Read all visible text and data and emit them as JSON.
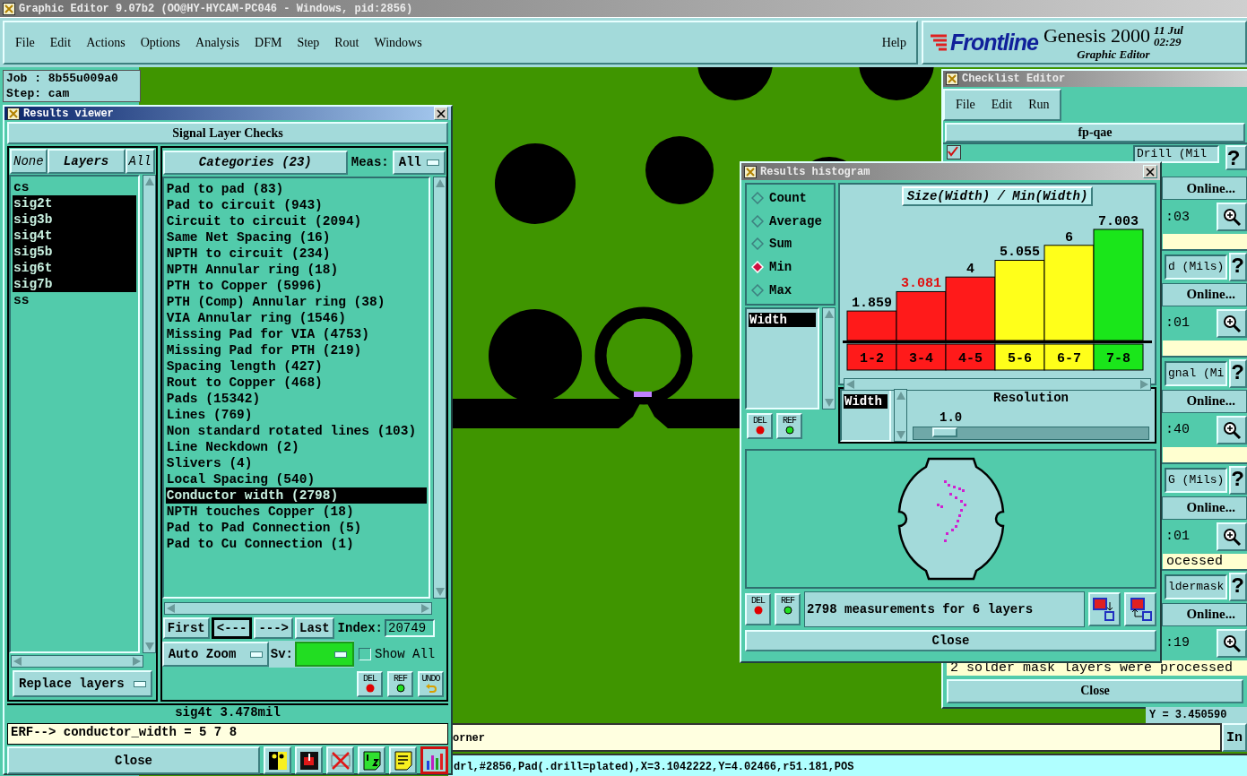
{
  "app": {
    "title": "Graphic Editor 9.07b2 (OO@HY-HYCAM-PC046 - Windows, pid:2856)",
    "active": false
  },
  "menu": [
    "File",
    "Edit",
    "Actions",
    "Options",
    "Analysis",
    "DFM",
    "Step",
    "Rout",
    "Windows"
  ],
  "help": "Help",
  "brand": {
    "logo": "Frontline",
    "product": "Genesis 2000",
    "subtitle": "Graphic Editor",
    "date": "11 Jul",
    "time": "02:29"
  },
  "job_info": [
    "Job : 8b55u009a0",
    "Step: cam"
  ],
  "results_viewer": {
    "title": "Results viewer",
    "active": true,
    "heading": "Signal Layer Checks",
    "layer_buttons": [
      {
        "label": "None",
        "kind": "button"
      },
      {
        "label": "Layers",
        "kind": "label"
      },
      {
        "label": "All",
        "kind": "button"
      }
    ],
    "layers": [
      {
        "label": "cs",
        "selected": false
      },
      {
        "label": "sig2t",
        "selected": true
      },
      {
        "label": "sig3b",
        "selected": true
      },
      {
        "label": "sig4t",
        "selected": true
      },
      {
        "label": "sig5b",
        "selected": true
      },
      {
        "label": "sig6t",
        "selected": true
      },
      {
        "label": "sig7b",
        "selected": true
      },
      {
        "label": "ss",
        "selected": false
      }
    ],
    "replace_mode": "Replace layers",
    "categories_heading": "Categories (23)",
    "meas_label": "Meas:",
    "meas_value": "All",
    "categories": [
      {
        "label": "Pad to pad (83)",
        "selected": false
      },
      {
        "label": "Pad to circuit (943)",
        "selected": false
      },
      {
        "label": "Circuit to circuit (2094)",
        "selected": false
      },
      {
        "label": "Same Net Spacing (16)",
        "selected": false
      },
      {
        "label": "NPTH to circuit (234)",
        "selected": false
      },
      {
        "label": "NPTH Annular ring (18)",
        "selected": false
      },
      {
        "label": "PTH to Copper (5996)",
        "selected": false
      },
      {
        "label": "PTH (Comp) Annular ring (38)",
        "selected": false
      },
      {
        "label": "VIA Annular ring (1546)",
        "selected": false
      },
      {
        "label": "Missing Pad for VIA (4753)",
        "selected": false
      },
      {
        "label": "Missing Pad for PTH (219)",
        "selected": false
      },
      {
        "label": "Spacing length (427)",
        "selected": false
      },
      {
        "label": "Rout to Copper (468)",
        "selected": false
      },
      {
        "label": "Pads (15342)",
        "selected": false
      },
      {
        "label": "Lines (769)",
        "selected": false
      },
      {
        "label": "Non standard rotated lines (103)",
        "selected": false
      },
      {
        "label": "Line Neckdown (2)",
        "selected": false
      },
      {
        "label": "Slivers (4)",
        "selected": false
      },
      {
        "label": "Local Spacing (540)",
        "selected": false
      },
      {
        "label": "Conductor width (2798)",
        "selected": true
      },
      {
        "label": "NPTH touches Copper (18)",
        "selected": false
      },
      {
        "label": "Pad to Pad Connection (5)",
        "selected": false
      },
      {
        "label": "Pad to Cu Connection (1)",
        "selected": false
      }
    ],
    "nav_buttons": [
      {
        "label": "First",
        "pressed": false
      },
      {
        "label": "<---",
        "pressed": true
      },
      {
        "label": "--->",
        "pressed": false
      },
      {
        "label": "Last",
        "pressed": false
      }
    ],
    "index_label": "Index:",
    "index_value": "20749",
    "zoom_mode": "Auto Zoom",
    "sv_label": "Sv:",
    "show_all": {
      "label": "Show All",
      "checked": false
    },
    "action_buttons": [
      {
        "label": "DEL",
        "kind": "del"
      },
      {
        "label": "REF",
        "kind": "ref"
      },
      {
        "label": "UNDO",
        "kind": "undo"
      }
    ],
    "readout": "sig4t 3.478mil",
    "erf_line": "ERF--> conductor_width = 5 7 8",
    "close": "Close",
    "tools": [
      {
        "kind": "figure",
        "selected": false
      },
      {
        "kind": "marker",
        "selected": false
      },
      {
        "kind": "cross",
        "selected": false
      },
      {
        "kind": "page",
        "selected": false
      },
      {
        "kind": "notes",
        "selected": false
      },
      {
        "kind": "chart",
        "selected": true
      }
    ]
  },
  "histogram": {
    "title": "Results histogram",
    "active": false,
    "modes": [
      {
        "label": "Count",
        "selected": false
      },
      {
        "label": "Average",
        "selected": false
      },
      {
        "label": "Sum",
        "selected": false
      },
      {
        "label": "Min",
        "selected": true
      },
      {
        "label": "Max",
        "selected": false
      }
    ],
    "attributes": [
      {
        "label": "Width",
        "selected": true
      }
    ],
    "buttons": [
      {
        "label": "DEL",
        "kind": "del"
      },
      {
        "label": "REF",
        "kind": "ref"
      }
    ],
    "chart_data": {
      "type": "bar",
      "title": "Size(Width) / Min(Width)",
      "categories": [
        "1-2",
        "3-4",
        "4-5",
        "5-6",
        "6-7",
        "7-8"
      ],
      "series": [
        {
          "color": "#ff1a1a",
          "values": [
            1.859,
            3.081,
            4,
            null,
            null,
            null
          ]
        },
        {
          "color": "#ffff1a",
          "values": [
            null,
            null,
            null,
            5.055,
            6,
            null
          ]
        },
        {
          "color": "#1ae61a",
          "values": [
            null,
            null,
            null,
            null,
            null,
            7.003
          ]
        }
      ],
      "data_labels": true
    },
    "bin_labels": [
      {
        "selected": false
      },
      {
        "selected": true
      },
      {
        "selected": false
      },
      {
        "selected": false
      },
      {
        "selected": false
      },
      {
        "selected": false
      }
    ],
    "resolution": {
      "attributes": [
        {
          "label": "Width",
          "selected": true
        }
      ],
      "label": "Resolution",
      "value": "1.0",
      "level": 0.08
    },
    "footer_buttons": [
      {
        "label": "DEL",
        "kind": "del"
      },
      {
        "label": "REF",
        "kind": "ref"
      }
    ],
    "summary": "2798 measurements for 6 layers",
    "close": "Close"
  },
  "checklist": {
    "title": "Checklist Editor",
    "active": false,
    "menu": [
      "File",
      "Edit",
      "Run"
    ],
    "name": "fp-qae",
    "checks": [
      {
        "checked": true,
        "field": "Drill (Mil",
        "help": "?",
        "state": "Online...",
        "time": ":03"
      },
      {
        "field": "d (Mils)",
        "help": "?",
        "state": "Online...",
        "time": ":01"
      },
      {
        "field": "gnal (Mi",
        "help": "?",
        "state": "Online...",
        "time": ":40"
      },
      {
        "field": "G (Mils)",
        "help": "?",
        "state": "Online...",
        "time": ":01",
        "message": "ocessed"
      },
      {
        "field": "ldermask",
        "help": "?",
        "state": "Online...",
        "time": ":19",
        "message": "2 solder mask layers were processed"
      }
    ],
    "close": "Close"
  },
  "status": {
    "coord": "Y = 3.450590",
    "message": "orner",
    "button": "In",
    "info": "drl,#2856,Pad(.drill=plated),X=3.1042222,Y=4.02466,r51.181,POS"
  }
}
